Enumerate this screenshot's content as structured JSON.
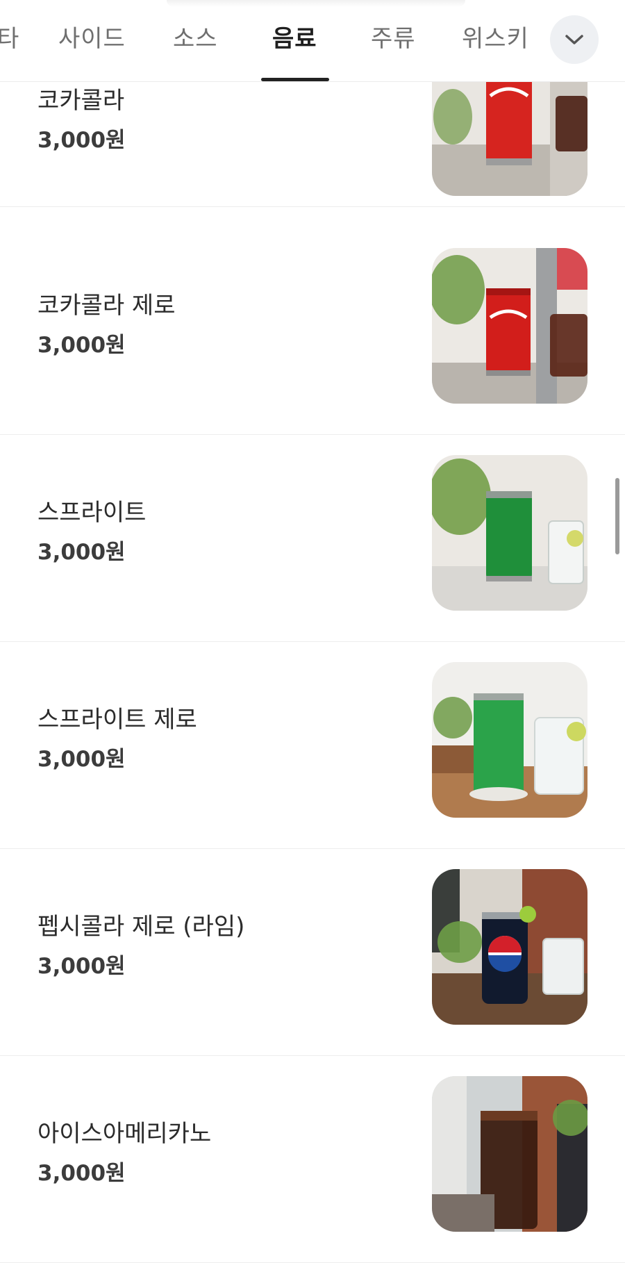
{
  "tabs": [
    {
      "label": "타",
      "active": false
    },
    {
      "label": "사이드",
      "active": false
    },
    {
      "label": "소스",
      "active": false
    },
    {
      "label": "음료",
      "active": true
    },
    {
      "label": "주류",
      "active": false
    },
    {
      "label": "위스키",
      "active": false
    }
  ],
  "more_icon": "chevron-down-icon",
  "items": [
    {
      "name": "코카콜라",
      "price": "3,000원",
      "image": "coca-cola-can-photo"
    },
    {
      "name": "코카콜라 제로",
      "price": "3,000원",
      "image": "coca-cola-zero-can-photo"
    },
    {
      "name": "스프라이트",
      "price": "3,000원",
      "image": "sprite-can-photo"
    },
    {
      "name": "스프라이트 제로",
      "price": "3,000원",
      "image": "sprite-zero-can-photo"
    },
    {
      "name": "펩시콜라 제로 (라임)",
      "price": "3,000원",
      "image": "pepsi-zero-lime-can-photo"
    },
    {
      "name": "아이스아메리카노",
      "price": "3,000원",
      "image": "iced-americano-photo"
    }
  ],
  "colors": {
    "active_tab": "#1f1f1f",
    "inactive_tab": "#6f6f6f",
    "price_text": "#3c3c3c",
    "divider": "#ededed"
  }
}
